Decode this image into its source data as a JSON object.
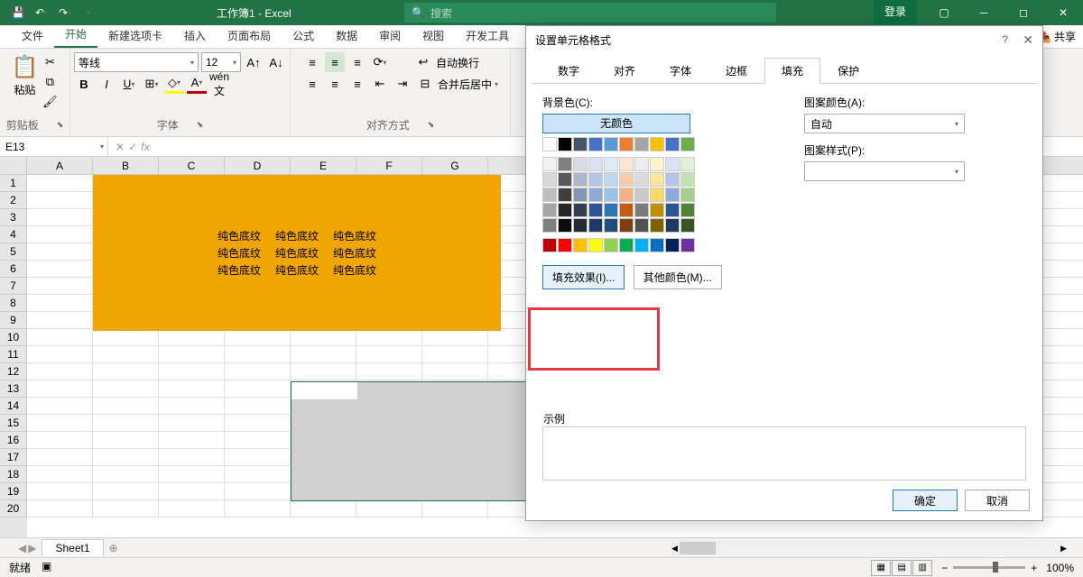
{
  "title": "工作簿1  -  Excel",
  "search_placeholder": "搜索",
  "login_label": "登录",
  "tabs": {
    "file": "文件",
    "home": "开始",
    "newtab": "新建选项卡",
    "insert": "插入",
    "layout": "页面布局",
    "formula": "公式",
    "data": "数据",
    "review": "审阅",
    "view": "视图",
    "dev": "开发工具"
  },
  "share_label": "共享",
  "clipboard": {
    "paste": "粘贴",
    "group": "剪贴板"
  },
  "font": {
    "name": "等线",
    "size": "12",
    "group": "字体",
    "wen": "wén",
    "wen2": "文"
  },
  "align": {
    "wrap": "自动换行",
    "merge": "合并后居中",
    "group": "对齐方式"
  },
  "namebox": "E13",
  "columns": [
    "A",
    "B",
    "C",
    "D",
    "E",
    "F",
    "G"
  ],
  "rows": [
    "1",
    "2",
    "3",
    "4",
    "5",
    "6",
    "7",
    "8",
    "9",
    "10",
    "11",
    "12",
    "13",
    "14",
    "15",
    "16",
    "17",
    "18",
    "19",
    "20"
  ],
  "cell_text": "纯色底纹",
  "sheet": {
    "name": "Sheet1"
  },
  "status": {
    "ready": "就绪",
    "zoom": "100%"
  },
  "dialog": {
    "title": "设置单元格格式",
    "tabs": {
      "number": "数字",
      "align": "对齐",
      "font": "字体",
      "border": "边框",
      "fill": "填充",
      "protect": "保护"
    },
    "bg_label": "背景色(C):",
    "no_color": "无颜色",
    "fill_effect": "填充效果(I)...",
    "more_color": "其他颜色(M)...",
    "pattern_color": "图案颜色(A):",
    "auto": "自动",
    "pattern_style": "图案样式(P):",
    "sample": "示例",
    "ok": "确定",
    "cancel": "取消"
  },
  "palette": {
    "row1": [
      "#ffffff",
      "#000000",
      "#44546a",
      "#4472c4",
      "#5b9bd5",
      "#ed7d31",
      "#a5a5a5",
      "#ffc000",
      "#4472c4",
      "#70ad47"
    ],
    "theme": [
      [
        "#f2f2f2",
        "#7f7f7f",
        "#d6dce4",
        "#d9e2f3",
        "#deebf6",
        "#fbe5d5",
        "#ededed",
        "#fff2cc",
        "#d9e2f3",
        "#e2efd9"
      ],
      [
        "#d8d8d8",
        "#595959",
        "#adb9ca",
        "#b4c6e7",
        "#bdd7ee",
        "#f7cbac",
        "#dbdbdb",
        "#fee599",
        "#b4c6e7",
        "#c5e0b3"
      ],
      [
        "#bfbfbf",
        "#3f3f3f",
        "#8496b0",
        "#8eaadb",
        "#9cc3e5",
        "#f4b183",
        "#c9c9c9",
        "#ffd965",
        "#8eaadb",
        "#a8d08d"
      ],
      [
        "#a5a5a5",
        "#262626",
        "#323f4f",
        "#2f5496",
        "#2e75b5",
        "#c55a11",
        "#7b7b7b",
        "#bf9000",
        "#2f5496",
        "#538135"
      ],
      [
        "#7f7f7f",
        "#0c0c0c",
        "#222a35",
        "#1f3864",
        "#1e4e79",
        "#833c0b",
        "#525252",
        "#7f6000",
        "#1f3864",
        "#375623"
      ]
    ],
    "std": [
      "#c00000",
      "#ff0000",
      "#ffc000",
      "#ffff00",
      "#92d050",
      "#00b050",
      "#00b0f0",
      "#0070c0",
      "#002060",
      "#7030a0"
    ]
  }
}
